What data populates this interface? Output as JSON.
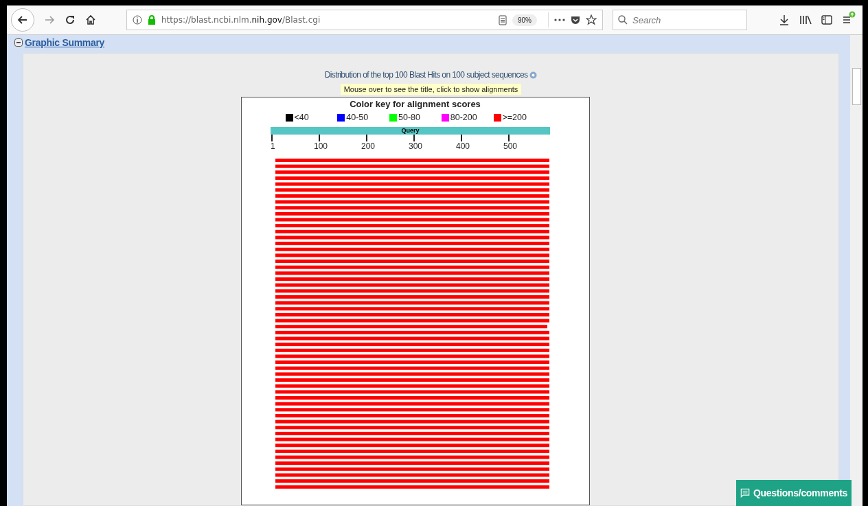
{
  "browser": {
    "url_prefix": "https://blast.ncbi.nlm.",
    "url_host": "nih.gov",
    "url_suffix": "/Blast.cgi",
    "zoom": "90%",
    "search_placeholder": "Search"
  },
  "section": {
    "title": "Graphic Summary",
    "expanded": true
  },
  "summary": {
    "heading": "Distribution of the top 100 Blast Hits on 100 subject sequences",
    "hint": "Mouse over to see the title, click to show alignments"
  },
  "color_key": {
    "title": "Color key for alignment scores",
    "items": [
      {
        "label": "<40",
        "color": "#000000"
      },
      {
        "label": "40-50",
        "color": "#0000ff"
      },
      {
        "label": "50-80",
        "color": "#00ff00"
      },
      {
        "label": "80-200",
        "color": "#ff00ff"
      },
      {
        "label": ">=200",
        "color": "#ff0000"
      }
    ]
  },
  "query": {
    "label": "Query",
    "ticks": [
      "1",
      "100",
      "200",
      "300",
      "400",
      "500"
    ]
  },
  "feedback_button": "Questions/comments"
}
